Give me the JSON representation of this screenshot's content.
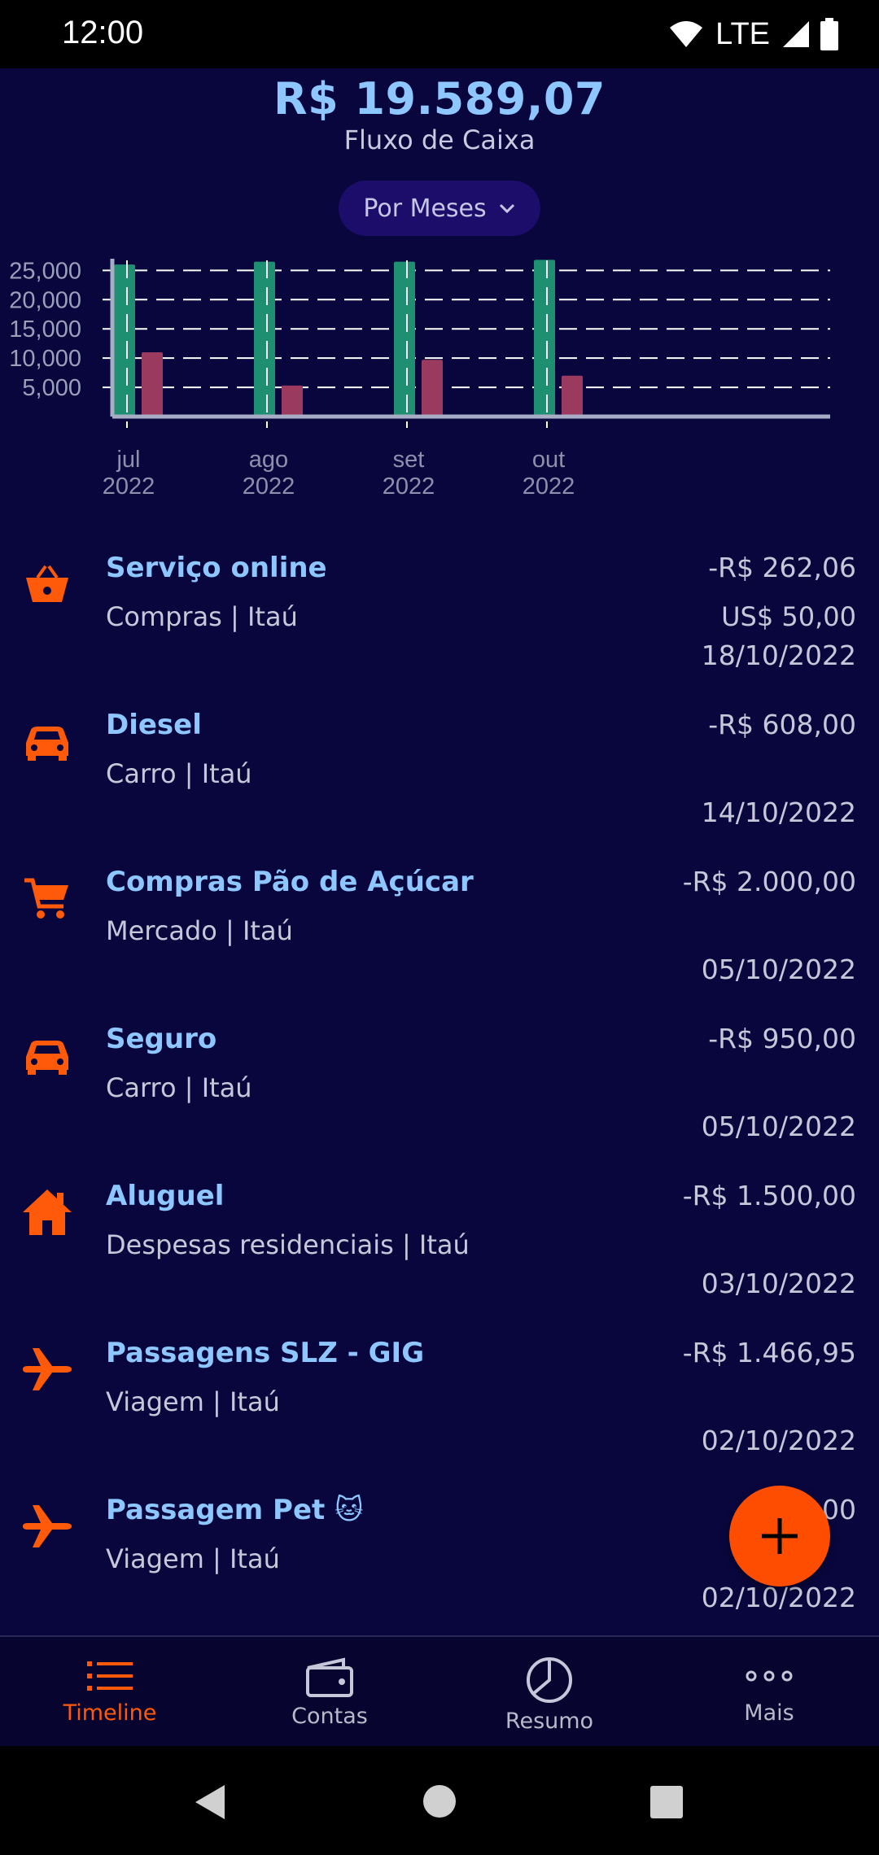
{
  "status_bar": {
    "time": "12:00",
    "network": "LTE"
  },
  "header": {
    "balance": "R$ 19.589,07",
    "caption": "Fluxo de Caixa",
    "period_selector": "Por Meses"
  },
  "colors": {
    "income": "#1f8f72",
    "expense": "#9a3a5e",
    "accent": "#ff5a0a",
    "title": "#8ec6ff",
    "background": "#08063d"
  },
  "chart_data": {
    "type": "bar",
    "categories": [
      "jul\n2022",
      "ago\n2022",
      "set\n2022",
      "out\n2022"
    ],
    "category_labels": [
      [
        "jul",
        "2022"
      ],
      [
        "ago",
        "2022"
      ],
      [
        "set",
        "2022"
      ],
      [
        "out",
        "2022"
      ]
    ],
    "series": [
      {
        "values": [
          26000,
          26500,
          26500,
          26800
        ],
        "color": "#1f8f72"
      },
      {
        "values": [
          11000,
          5300,
          9700,
          7000
        ],
        "color": "#9a3a5e"
      }
    ],
    "yticks": [
      5000,
      10000,
      15000,
      20000,
      25000
    ],
    "ytick_labels": [
      "5,000",
      "10,000",
      "15,000",
      "20,000",
      "25,000"
    ],
    "ylim": [
      0,
      27000
    ],
    "grid": true,
    "title": "",
    "xlabel": "",
    "ylabel": ""
  },
  "transactions": [
    {
      "icon": "basket-icon",
      "title": "Serviço online",
      "subtitle": "Compras | Itaú",
      "amount": "-R$ 262,06",
      "foreign": "US$ 50,00",
      "date": "18/10/2022"
    },
    {
      "icon": "car-icon",
      "title": "Diesel",
      "subtitle": "Carro | Itaú",
      "amount": "-R$ 608,00",
      "foreign": "",
      "date": "14/10/2022"
    },
    {
      "icon": "cart-icon",
      "title": "Compras Pão de Açúcar",
      "subtitle": "Mercado | Itaú",
      "amount": "-R$ 2.000,00",
      "foreign": "",
      "date": "05/10/2022"
    },
    {
      "icon": "car-icon",
      "title": "Seguro",
      "subtitle": "Carro | Itaú",
      "amount": "-R$ 950,00",
      "foreign": "",
      "date": "05/10/2022"
    },
    {
      "icon": "home-icon",
      "title": "Aluguel",
      "subtitle": "Despesas residenciais | Itaú",
      "amount": "-R$ 1.500,00",
      "foreign": "",
      "date": "03/10/2022"
    },
    {
      "icon": "airplane-icon",
      "title": "Passagens SLZ - GIG",
      "subtitle": "Viagem | Itaú",
      "amount": "-R$ 1.466,95",
      "foreign": "",
      "date": "02/10/2022"
    },
    {
      "icon": "airplane-icon",
      "title": "Passagem Pet 🐱",
      "subtitle": "Viagem | Itaú",
      "amount": "-R$ .00",
      "foreign": "",
      "date": "02/10/2022"
    }
  ],
  "nav": [
    {
      "label": "Timeline",
      "icon": "list-icon",
      "active": true
    },
    {
      "label": "Contas",
      "icon": "wallet-icon",
      "active": false
    },
    {
      "label": "Resumo",
      "icon": "pie-chart-icon",
      "active": false
    },
    {
      "label": "Mais",
      "icon": "more-icon",
      "active": false
    }
  ]
}
